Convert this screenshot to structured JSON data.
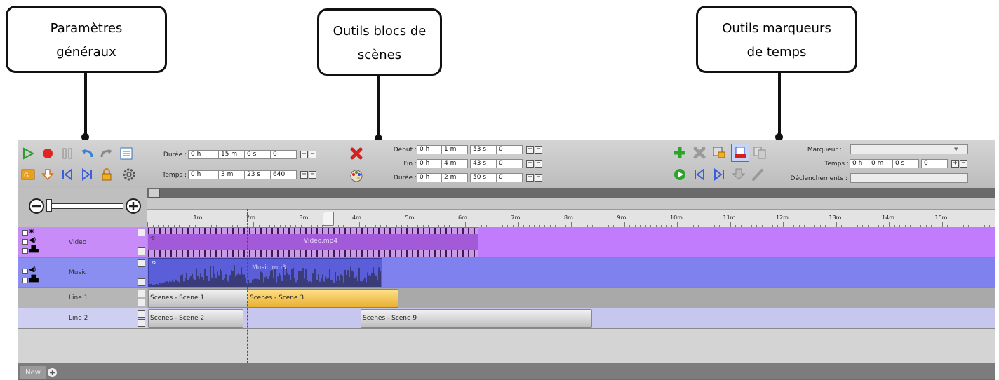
{
  "callouts": [
    {
      "id": "general",
      "lines": [
        "Paramètres",
        "généraux"
      ]
    },
    {
      "id": "scene",
      "lines": [
        "Outils blocs de",
        "scènes"
      ]
    },
    {
      "id": "marker",
      "lines": [
        "Outils marqueurs",
        "de temps"
      ]
    }
  ],
  "general": {
    "duree_label": "Durée :",
    "duree": {
      "h": "0 h",
      "m": "15 m",
      "s": "0 s",
      "f": "0"
    },
    "temps_label": "Temps :",
    "temps": {
      "h": "0 h",
      "m": "3 m",
      "s": "23 s",
      "f": "640"
    }
  },
  "scene_tools": {
    "debut_label": "Début :",
    "debut": {
      "h": "0 h",
      "m": "1 m",
      "s": "53 s",
      "f": "0"
    },
    "fin_label": "Fin :",
    "fin": {
      "h": "0 h",
      "m": "4 m",
      "s": "43 s",
      "f": "0"
    },
    "duree_label": "Durée :",
    "duree": {
      "h": "0 h",
      "m": "2 m",
      "s": "50 s",
      "f": "0"
    }
  },
  "marker_tools": {
    "marqueur_label": "Marqueur :",
    "marqueur_value": "",
    "temps_label": "Temps :",
    "temps": {
      "h": "0 h",
      "m": "0 m",
      "s": "0 s",
      "f": "0"
    },
    "declenchements_label": "Déclenchements :",
    "declenchements_value": ""
  },
  "ruler": {
    "ticks": [
      "1m",
      "2m",
      "3m",
      "4m",
      "5m",
      "6m",
      "7m",
      "8m",
      "9m",
      "10m",
      "11m",
      "12m",
      "13m",
      "14m",
      "15m"
    ]
  },
  "tracks": {
    "video": {
      "name": "Video",
      "clip": "Video.mp4"
    },
    "music": {
      "name": "Music",
      "clip": "Music.mp3"
    },
    "line1": {
      "name": "Line 1",
      "clips": [
        "Scenes - Scene 1",
        "Scenes - Scene 3"
      ]
    },
    "line2": {
      "name": "Line 2",
      "clips": [
        "Scenes - Scene 2",
        "Scenes - Scene 9"
      ]
    }
  },
  "tabs": {
    "new": "New"
  },
  "colors": {
    "video": "#c07cfc",
    "music": "#7f82ee",
    "selected_clip": "#f1c54a",
    "line2": "#c6c6ef",
    "playhead": "#e02020"
  }
}
